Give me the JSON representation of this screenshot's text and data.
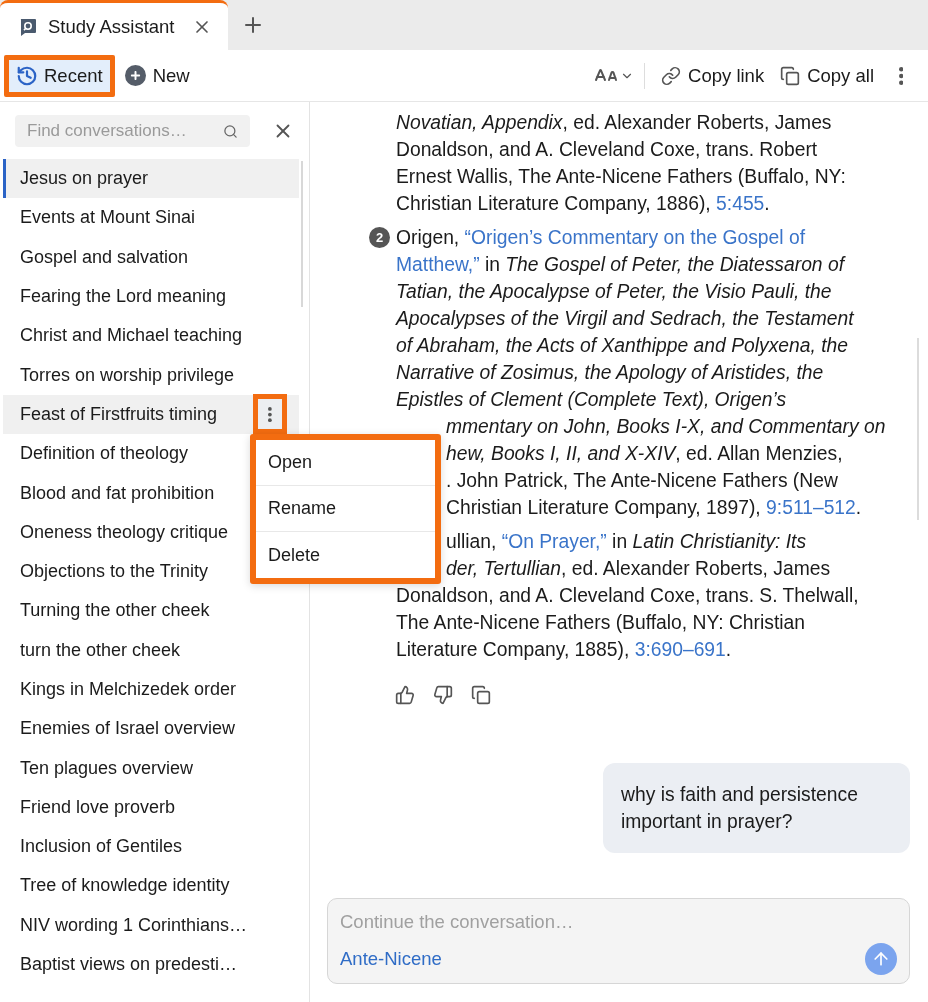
{
  "tabs": [
    {
      "label": "Study Assistant",
      "selected": true
    }
  ],
  "toolbar": {
    "recent": {
      "label": "Recent",
      "selected": true,
      "highlighted": true
    },
    "new_label": "New",
    "copy_link": "Copy link",
    "copy_all": "Copy all"
  },
  "sidebar": {
    "search": {
      "placeholder": "Find conversations…"
    },
    "items": [
      {
        "label": "Jesus on prayer",
        "selected": true,
        "menu_open": false
      },
      {
        "label": "Events at Mount Sinai",
        "selected": false,
        "menu_open": false
      },
      {
        "label": "Gospel and salvation",
        "selected": false,
        "menu_open": false
      },
      {
        "label": "Fearing the Lord meaning",
        "selected": false,
        "menu_open": false
      },
      {
        "label": "Christ and Michael teaching",
        "selected": false,
        "menu_open": false
      },
      {
        "label": "Torres on worship privilege",
        "selected": false,
        "menu_open": false
      },
      {
        "label": "Feast of Firstfruits timing",
        "selected": false,
        "menu_open": true
      },
      {
        "label": "Definition of theology",
        "selected": false,
        "menu_open": false
      },
      {
        "label": "Blood and fat prohibition",
        "selected": false,
        "menu_open": false
      },
      {
        "label": "Oneness theology critique",
        "selected": false,
        "menu_open": false
      },
      {
        "label": "Objections to the Trinity",
        "selected": false,
        "menu_open": false
      },
      {
        "label": "Turning the other cheek",
        "selected": false,
        "menu_open": false
      },
      {
        "label": "turn the other cheek",
        "selected": false,
        "menu_open": false
      },
      {
        "label": "Kings in Melchizedek order",
        "selected": false,
        "menu_open": false
      },
      {
        "label": "Enemies of Israel overview",
        "selected": false,
        "menu_open": false
      },
      {
        "label": "Ten plagues overview",
        "selected": false,
        "menu_open": false
      },
      {
        "label": "Friend love proverb",
        "selected": false,
        "menu_open": false
      },
      {
        "label": "Inclusion of Gentiles",
        "selected": false,
        "menu_open": false
      },
      {
        "label": "Tree of knowledge identity",
        "selected": false,
        "menu_open": false
      },
      {
        "label": "NIV wording 1 Corinthians…",
        "selected": false,
        "menu_open": false
      },
      {
        "label": "Baptist views on predesti…",
        "selected": false,
        "menu_open": false
      }
    ],
    "menu": {
      "highlighted": true,
      "items": [
        "Open",
        "Rename",
        "Delete"
      ]
    }
  },
  "references": [
    {
      "lines": [
        {
          "covered": false,
          "segments": [
            {
              "kind": "text",
              "text": "*Novatian, Appendix*, ed. Alexander Roberts, James"
            }
          ]
        },
        {
          "covered": false,
          "segments": [
            {
              "kind": "text",
              "text": "Donaldson, and A. Cleveland Coxe, trans. Robert"
            }
          ]
        },
        {
          "covered": false,
          "segments": [
            {
              "kind": "text",
              "text": "Ernest Wallis, The Ante-Nicene Fathers (Buffalo, NY:"
            }
          ]
        },
        {
          "covered": false,
          "segments": [
            {
              "kind": "text",
              "text": "Christian Literature Company, 1886), "
            },
            {
              "kind": "link",
              "text": "5:455"
            },
            {
              "kind": "text",
              "text": "."
            }
          ]
        }
      ]
    },
    {
      "number": "2",
      "lines": [
        {
          "covered": false,
          "segments": [
            {
              "kind": "text",
              "text": "Origen, "
            },
            {
              "kind": "link",
              "text": "“Origen’s Commentary on the Gospel of"
            }
          ]
        },
        {
          "covered": false,
          "segments": [
            {
              "kind": "link",
              "text": "Matthew,”"
            },
            {
              "kind": "text",
              "text": " in *The Gospel of Peter, the Diatessaron of*"
            }
          ]
        },
        {
          "covered": false,
          "segments": [
            {
              "kind": "text",
              "text": "*Tatian, the Apocalypse of Peter, the Visio Pauli, the*"
            }
          ]
        },
        {
          "covered": false,
          "segments": [
            {
              "kind": "text",
              "text": "*Apocalypses of the Virgil and Sedrach, the Testament*"
            }
          ]
        },
        {
          "covered": false,
          "segments": [
            {
              "kind": "text",
              "text": "*of Abraham, the Acts of Xanthippe and Polyxena, the*"
            }
          ]
        },
        {
          "covered": false,
          "segments": [
            {
              "kind": "text",
              "text": "*Narrative of Zosimus, the Apology of Aristides, the*"
            }
          ]
        },
        {
          "covered": false,
          "segments": [
            {
              "kind": "text",
              "text": "*Epistles of Clement (Complete Text), Origen’s*"
            }
          ]
        },
        {
          "covered": true,
          "segments": [
            {
              "kind": "text",
              "text": "*mmentary on John, Books I-X, and Commentary on*"
            }
          ]
        },
        {
          "covered": true,
          "segments": [
            {
              "kind": "text",
              "text": "*hew, Books I, II, and X-XIV*, ed. Allan Menzies,"
            }
          ]
        },
        {
          "covered": true,
          "segments": [
            {
              "kind": "text",
              "text": ". John Patrick, The Ante-Nicene Fathers (New"
            }
          ]
        },
        {
          "covered": true,
          "segments": [
            {
              "kind": "text",
              "text": "Christian Literature Company, 1897), "
            },
            {
              "kind": "link",
              "text": "9:511–512"
            },
            {
              "kind": "text",
              "text": "."
            }
          ]
        }
      ]
    },
    {
      "lines": [
        {
          "covered": true,
          "segments": [
            {
              "kind": "text",
              "text": "ullian, "
            },
            {
              "kind": "link",
              "text": "“On Prayer,”"
            },
            {
              "kind": "text",
              "text": " in *Latin Christianity: Its*"
            }
          ]
        },
        {
          "covered": true,
          "segments": [
            {
              "kind": "text",
              "text": "*der, Tertullian*, ed. Alexander Roberts, James"
            }
          ]
        },
        {
          "covered": false,
          "segments": [
            {
              "kind": "text",
              "text": "Donaldson, and A. Cleveland Coxe, trans. S. Thelwall,"
            }
          ]
        },
        {
          "covered": false,
          "segments": [
            {
              "kind": "text",
              "text": "The Ante-Nicene Fathers (Buffalo, NY: Christian"
            }
          ]
        },
        {
          "covered": false,
          "segments": [
            {
              "kind": "text",
              "text": "Literature Company, 1885), "
            },
            {
              "kind": "link",
              "text": "3:690–691"
            },
            {
              "kind": "text",
              "text": "."
            }
          ]
        }
      ]
    }
  ],
  "user_message": "why is faith and persistence important in prayer?",
  "composer": {
    "placeholder": "Continue the conversation…",
    "tag": "Ante-Nicene"
  }
}
